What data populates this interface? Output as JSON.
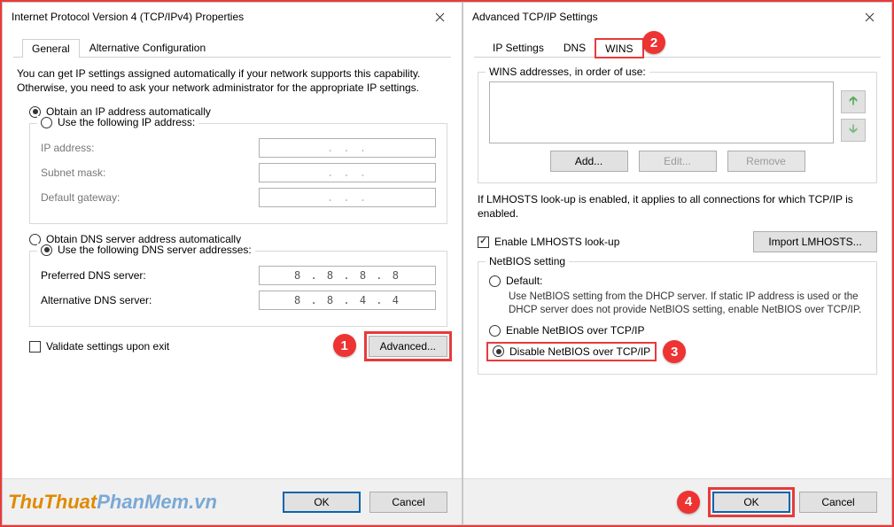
{
  "left": {
    "title": "Internet Protocol Version 4 (TCP/IPv4) Properties",
    "tabs": {
      "general": "General",
      "alt": "Alternative Configuration"
    },
    "desc": "You can get IP settings assigned automatically if your network supports this capability. Otherwise, you need to ask your network administrator for the appropriate IP settings.",
    "radio_ip_auto": "Obtain an IP address automatically",
    "radio_ip_manual": "Use the following IP address:",
    "fields": {
      "ip": "IP address:",
      "subnet": "Subnet mask:",
      "gateway": "Default gateway:",
      "dots": ".       .       ."
    },
    "radio_dns_auto": "Obtain DNS server address automatically",
    "radio_dns_manual": "Use the following DNS server addresses:",
    "dns_pref_label": "Preferred DNS server:",
    "dns_pref_val": "8 . 8 . 8 . 8",
    "dns_alt_label": "Alternative DNS server:",
    "dns_alt_val": "8 . 8 . 4 . 4",
    "validate": "Validate settings upon exit",
    "advanced": "Advanced...",
    "ok": "OK",
    "cancel": "Cancel"
  },
  "right": {
    "title": "Advanced TCP/IP Settings",
    "tabs": {
      "ip": "IP Settings",
      "dns": "DNS",
      "wins": "WINS"
    },
    "wins_legend": "WINS addresses, in order of use:",
    "add": "Add...",
    "edit": "Edit...",
    "remove": "Remove",
    "lmhosts_desc": "If LMHOSTS look-up is enabled, it applies to all connections for which TCP/IP is enabled.",
    "lmhosts_check": "Enable LMHOSTS look-up",
    "import": "Import LMHOSTS...",
    "netbios_legend": "NetBIOS setting",
    "nb_default": "Default:",
    "nb_default_desc": "Use NetBIOS setting from the DHCP server. If static IP address is used or the DHCP server does not provide NetBIOS setting, enable NetBIOS over TCP/IP.",
    "nb_enable": "Enable NetBIOS over TCP/IP",
    "nb_disable": "Disable NetBIOS over TCP/IP",
    "ok": "OK",
    "cancel": "Cancel"
  },
  "markers": {
    "m1": "1",
    "m2": "2",
    "m3": "3",
    "m4": "4"
  },
  "watermark": {
    "a": "ThuThuat",
    "b": "PhanMem",
    "c": ".vn"
  }
}
